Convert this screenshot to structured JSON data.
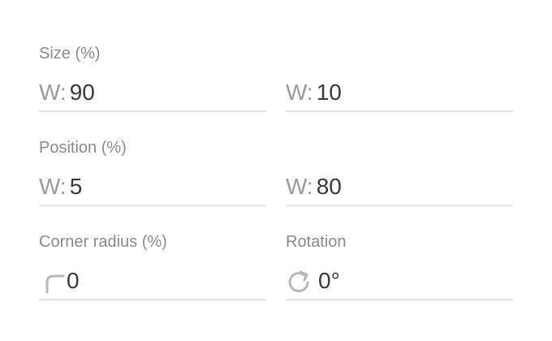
{
  "size": {
    "label": "Size (%)",
    "width": {
      "prefix": "W:",
      "value": "90"
    },
    "height": {
      "prefix": "W:",
      "value": "10"
    }
  },
  "position": {
    "label": "Position (%)",
    "x": {
      "prefix": "W:",
      "value": "5"
    },
    "y": {
      "prefix": "W:",
      "value": "80"
    }
  },
  "corner_radius": {
    "label": "Corner radius (%)",
    "icon": "corner-radius-icon",
    "value": "0"
  },
  "rotation": {
    "label": "Rotation",
    "icon": "rotate-icon",
    "value": "0°"
  },
  "colors": {
    "label": "#8a8a8e",
    "value": "#3a3a3e",
    "divider": "#e3e3e6",
    "icon": "#b8b8bc"
  }
}
